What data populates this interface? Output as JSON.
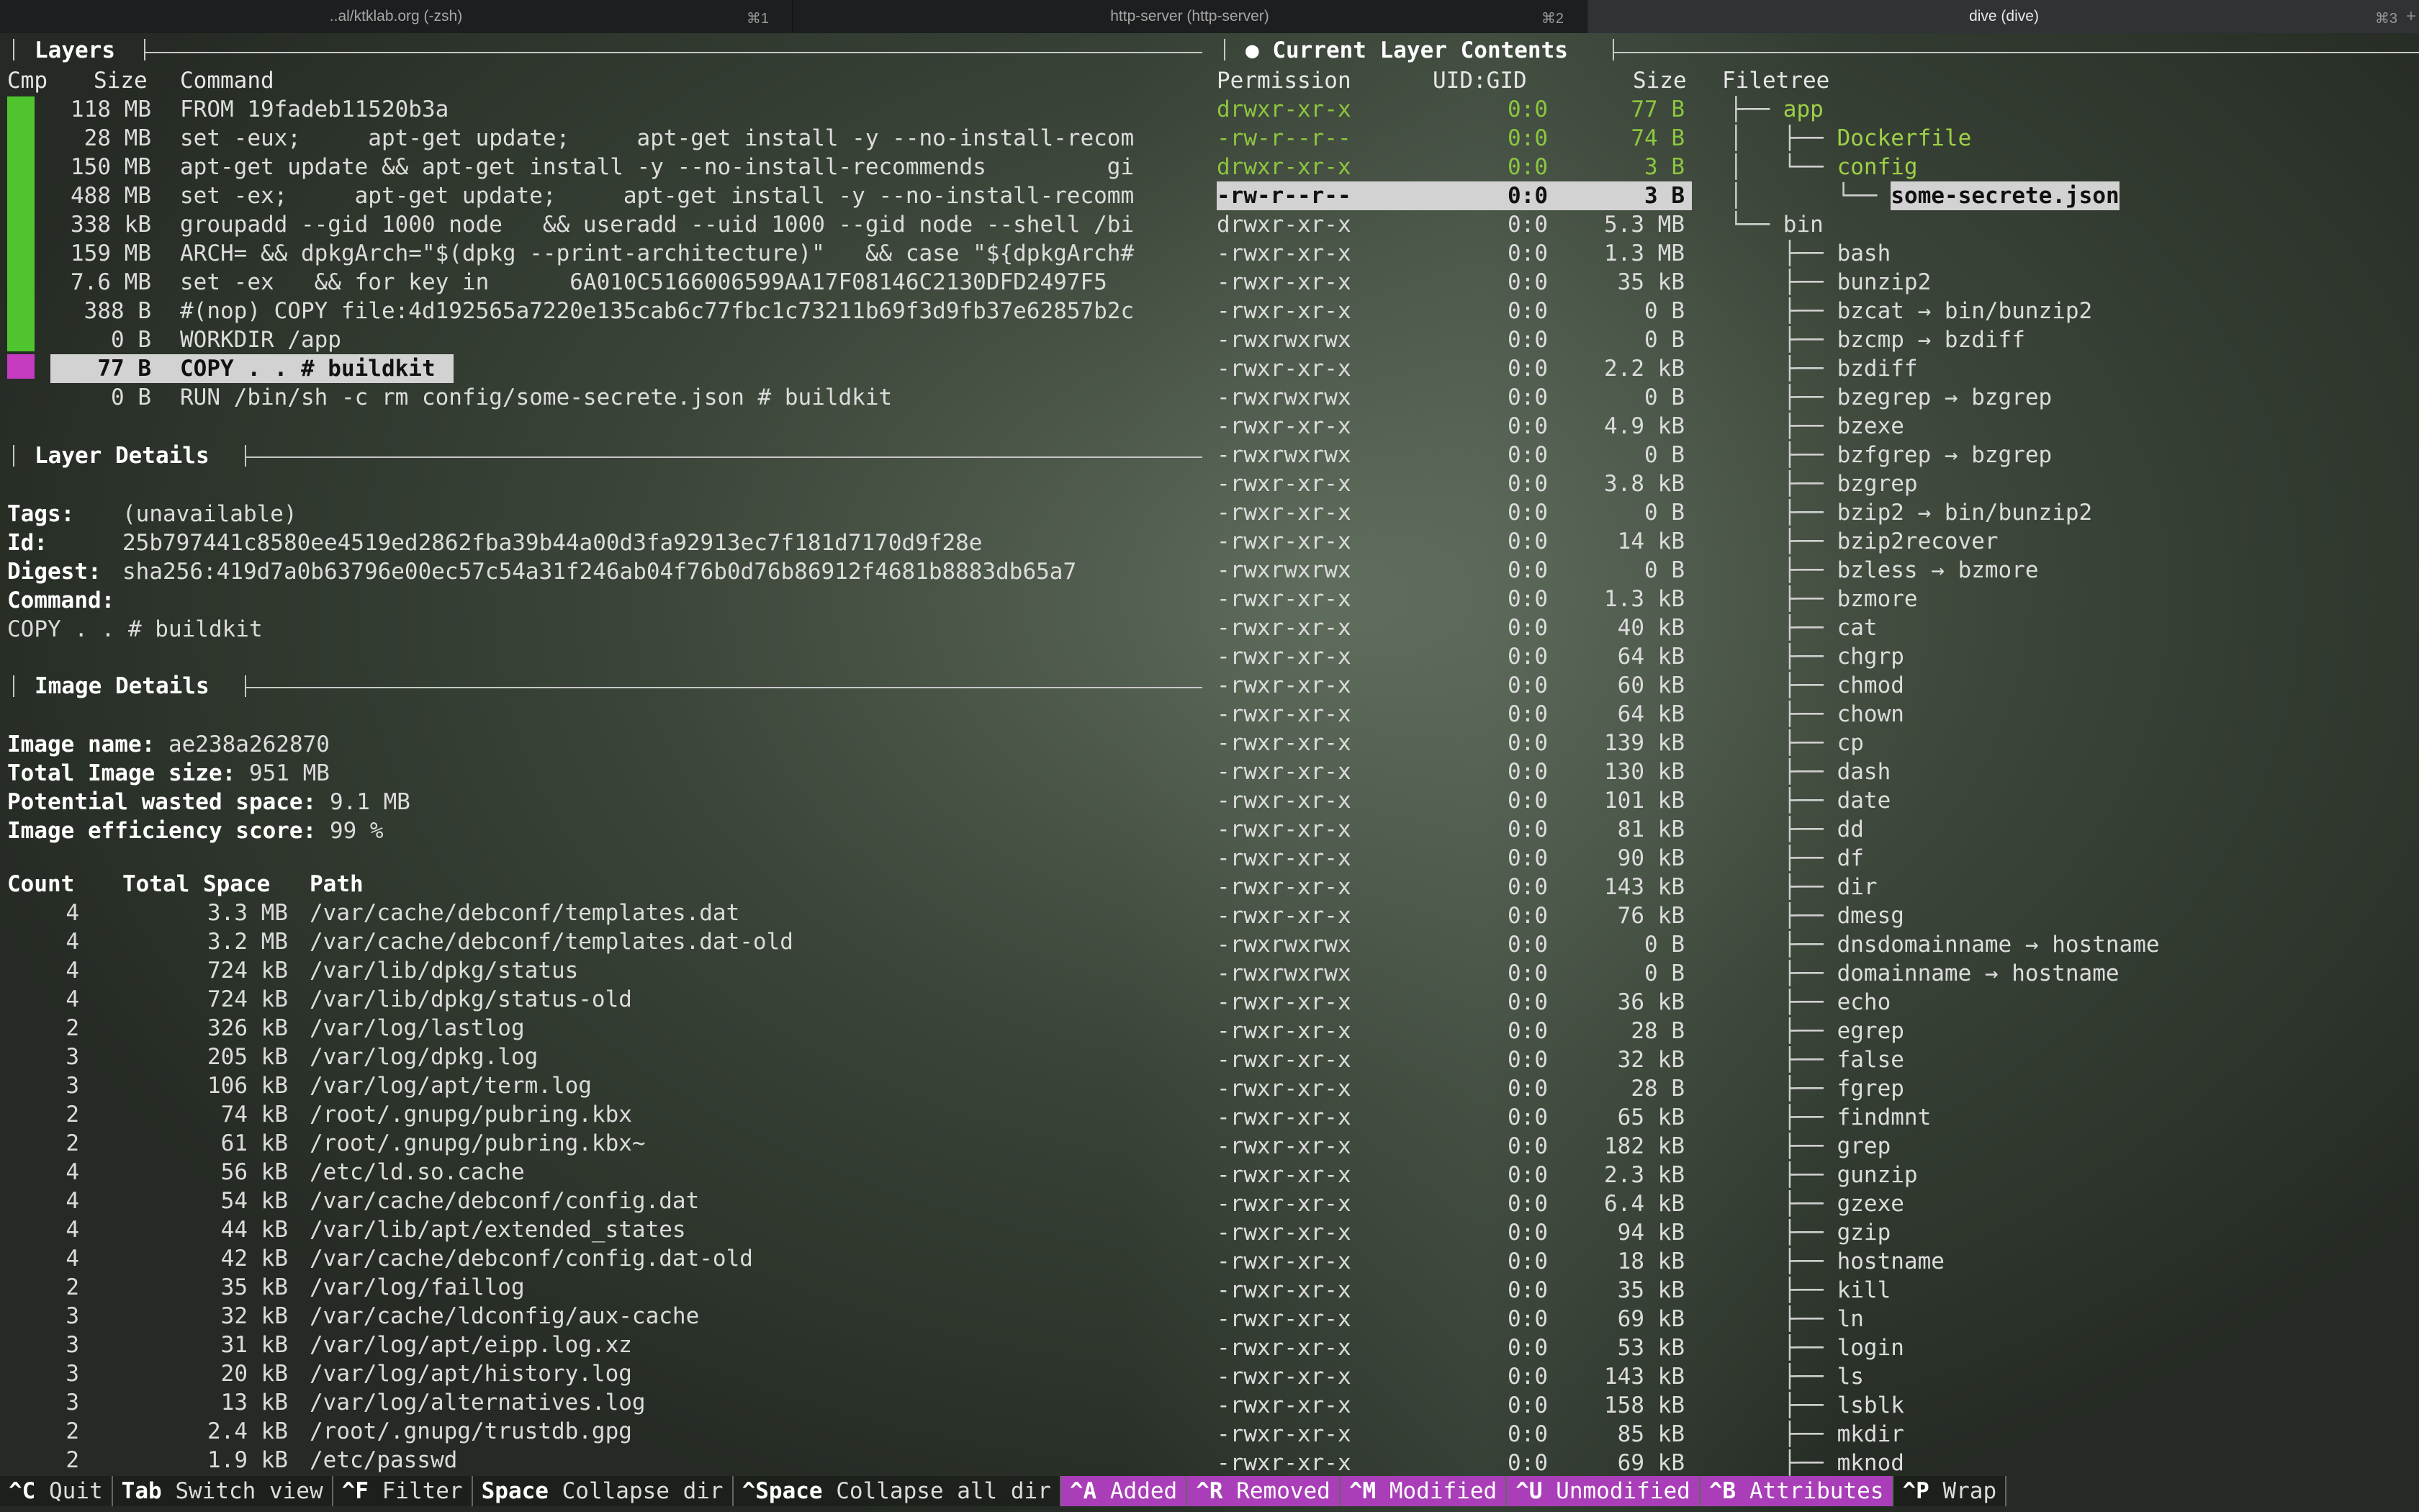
{
  "tabs": [
    {
      "label": "..al/ktklab.org (-zsh)",
      "shortcut": "⌘1"
    },
    {
      "label": "http-server (http-server)",
      "shortcut": "⌘2"
    },
    {
      "label": "dive (dive)",
      "shortcut": "⌘3"
    }
  ],
  "layers": {
    "title": "Layers",
    "headers": {
      "cmp": "Cmp",
      "size": "Size",
      "command": "Command"
    },
    "rows": [
      {
        "size": "118 MB",
        "command": "FROM 19fadeb11520b3a"
      },
      {
        "size": "28 MB",
        "command": "set -eux;     apt-get update;     apt-get install -y --no-install-recom"
      },
      {
        "size": "150 MB",
        "command": "apt-get update && apt-get install -y --no-install-recommends         gi"
      },
      {
        "size": "488 MB",
        "command": "set -ex;     apt-get update;     apt-get install -y --no-install-recomm"
      },
      {
        "size": "338 kB",
        "command": "groupadd --gid 1000 node   && useradd --uid 1000 --gid node --shell /bi"
      },
      {
        "size": "159 MB",
        "command": "ARCH= && dpkgArch=\"$(dpkg --print-architecture)\"   && case \"${dpkgArch#"
      },
      {
        "size": "7.6 MB",
        "command": "set -ex   && for key in      6A010C5166006599AA17F08146C2130DFD2497F5"
      },
      {
        "size": "388 B",
        "command": "#(nop) COPY file:4d192565a7220e135cab6c77fbc1c73211b69f3d9fb37e62857b2c"
      },
      {
        "size": "0 B",
        "command": "WORKDIR /app"
      },
      {
        "size": "77 B",
        "command": "COPY . . # buildkit"
      },
      {
        "size": "0 B",
        "command": "RUN /bin/sh -c rm config/some-secrete.json # buildkit"
      }
    ]
  },
  "layer_details": {
    "title": "Layer Details",
    "tags_label": "Tags:",
    "tags": "(unavailable)",
    "id_label": "Id:",
    "id": "25b797441c8580ee4519ed2862fba39b44a00d3fa92913ec7f181d7170d9f28e",
    "digest_label": "Digest:",
    "digest": "sha256:419d7a0b63796e00ec57c54a31f246ab04f76b0d76b86912f4681b8883db65a7",
    "command_label": "Command:",
    "command": "COPY . . # buildkit"
  },
  "image_details": {
    "title": "Image Details",
    "name_label": "Image name:",
    "name": "ae238a262870",
    "size_label": "Total Image size:",
    "size": "951 MB",
    "wasted_label": "Potential wasted space:",
    "wasted": "9.1 MB",
    "eff_label": "Image efficiency score:",
    "eff": "99 %",
    "headers": {
      "count": "Count",
      "total": "Total Space",
      "path": "Path"
    },
    "rows": [
      {
        "count": "4",
        "total": "3.3 MB",
        "path": "/var/cache/debconf/templates.dat"
      },
      {
        "count": "4",
        "total": "3.2 MB",
        "path": "/var/cache/debconf/templates.dat-old"
      },
      {
        "count": "4",
        "total": "724 kB",
        "path": "/var/lib/dpkg/status"
      },
      {
        "count": "4",
        "total": "724 kB",
        "path": "/var/lib/dpkg/status-old"
      },
      {
        "count": "2",
        "total": "326 kB",
        "path": "/var/log/lastlog"
      },
      {
        "count": "3",
        "total": "205 kB",
        "path": "/var/log/dpkg.log"
      },
      {
        "count": "3",
        "total": "106 kB",
        "path": "/var/log/apt/term.log"
      },
      {
        "count": "2",
        "total": "74 kB",
        "path": "/root/.gnupg/pubring.kbx"
      },
      {
        "count": "2",
        "total": "61 kB",
        "path": "/root/.gnupg/pubring.kbx~"
      },
      {
        "count": "4",
        "total": "56 kB",
        "path": "/etc/ld.so.cache"
      },
      {
        "count": "4",
        "total": "54 kB",
        "path": "/var/cache/debconf/config.dat"
      },
      {
        "count": "4",
        "total": "44 kB",
        "path": "/var/lib/apt/extended_states"
      },
      {
        "count": "4",
        "total": "42 kB",
        "path": "/var/cache/debconf/config.dat-old"
      },
      {
        "count": "2",
        "total": "35 kB",
        "path": "/var/log/faillog"
      },
      {
        "count": "3",
        "total": "32 kB",
        "path": "/var/cache/ldconfig/aux-cache"
      },
      {
        "count": "3",
        "total": "31 kB",
        "path": "/var/log/apt/eipp.log.xz"
      },
      {
        "count": "3",
        "total": "20 kB",
        "path": "/var/log/apt/history.log"
      },
      {
        "count": "3",
        "total": "13 kB",
        "path": "/var/log/alternatives.log"
      },
      {
        "count": "2",
        "total": "2.4 kB",
        "path": "/root/.gnupg/trustdb.gpg"
      },
      {
        "count": "2",
        "total": "1.9 kB",
        "path": "/etc/passwd"
      }
    ]
  },
  "contents": {
    "title": "● Current Layer Contents",
    "headers": {
      "perm": "Permission",
      "uid": "UID:GID",
      "size": "Size",
      "tree": "Filetree"
    },
    "rows": [
      {
        "perm": "drwxr-xr-x",
        "uid": "0:0",
        "size": "77 B",
        "prefix": "├── ",
        "name": "app",
        "style": "green"
      },
      {
        "perm": "-rw-r--r--",
        "uid": "0:0",
        "size": "74 B",
        "prefix": "│   ├── ",
        "name": "Dockerfile",
        "style": "green"
      },
      {
        "perm": "drwxr-xr-x",
        "uid": "0:0",
        "size": "3 B",
        "prefix": "│   └── ",
        "name": "config",
        "style": "green"
      },
      {
        "perm": "-rw-r--r--",
        "uid": "0:0",
        "size": "3 B",
        "prefix": "│       └── ",
        "name": "some-secrete.json",
        "style": "hl"
      },
      {
        "perm": "drwxr-xr-x",
        "uid": "0:0",
        "size": "5.3 MB",
        "prefix": "└── ",
        "name": "bin",
        "style": ""
      },
      {
        "perm": "-rwxr-xr-x",
        "uid": "0:0",
        "size": "1.3 MB",
        "prefix": "    ├── ",
        "name": "bash",
        "style": ""
      },
      {
        "perm": "-rwxr-xr-x",
        "uid": "0:0",
        "size": "35 kB",
        "prefix": "    ├── ",
        "name": "bunzip2",
        "style": ""
      },
      {
        "perm": "-rwxr-xr-x",
        "uid": "0:0",
        "size": "0 B",
        "prefix": "    ├── ",
        "name": "bzcat → bin/bunzip2",
        "style": ""
      },
      {
        "perm": "-rwxrwxrwx",
        "uid": "0:0",
        "size": "0 B",
        "prefix": "    ├── ",
        "name": "bzcmp → bzdiff",
        "style": ""
      },
      {
        "perm": "-rwxr-xr-x",
        "uid": "0:0",
        "size": "2.2 kB",
        "prefix": "    ├── ",
        "name": "bzdiff",
        "style": ""
      },
      {
        "perm": "-rwxrwxrwx",
        "uid": "0:0",
        "size": "0 B",
        "prefix": "    ├── ",
        "name": "bzegrep → bzgrep",
        "style": ""
      },
      {
        "perm": "-rwxr-xr-x",
        "uid": "0:0",
        "size": "4.9 kB",
        "prefix": "    ├── ",
        "name": "bzexe",
        "style": ""
      },
      {
        "perm": "-rwxrwxrwx",
        "uid": "0:0",
        "size": "0 B",
        "prefix": "    ├── ",
        "name": "bzfgrep → bzgrep",
        "style": ""
      },
      {
        "perm": "-rwxr-xr-x",
        "uid": "0:0",
        "size": "3.8 kB",
        "prefix": "    ├── ",
        "name": "bzgrep",
        "style": ""
      },
      {
        "perm": "-rwxr-xr-x",
        "uid": "0:0",
        "size": "0 B",
        "prefix": "    ├── ",
        "name": "bzip2 → bin/bunzip2",
        "style": ""
      },
      {
        "perm": "-rwxr-xr-x",
        "uid": "0:0",
        "size": "14 kB",
        "prefix": "    ├── ",
        "name": "bzip2recover",
        "style": ""
      },
      {
        "perm": "-rwxrwxrwx",
        "uid": "0:0",
        "size": "0 B",
        "prefix": "    ├── ",
        "name": "bzless → bzmore",
        "style": ""
      },
      {
        "perm": "-rwxr-xr-x",
        "uid": "0:0",
        "size": "1.3 kB",
        "prefix": "    ├── ",
        "name": "bzmore",
        "style": ""
      },
      {
        "perm": "-rwxr-xr-x",
        "uid": "0:0",
        "size": "40 kB",
        "prefix": "    ├── ",
        "name": "cat",
        "style": ""
      },
      {
        "perm": "-rwxr-xr-x",
        "uid": "0:0",
        "size": "64 kB",
        "prefix": "    ├── ",
        "name": "chgrp",
        "style": ""
      },
      {
        "perm": "-rwxr-xr-x",
        "uid": "0:0",
        "size": "60 kB",
        "prefix": "    ├── ",
        "name": "chmod",
        "style": ""
      },
      {
        "perm": "-rwxr-xr-x",
        "uid": "0:0",
        "size": "64 kB",
        "prefix": "    ├── ",
        "name": "chown",
        "style": ""
      },
      {
        "perm": "-rwxr-xr-x",
        "uid": "0:0",
        "size": "139 kB",
        "prefix": "    ├── ",
        "name": "cp",
        "style": ""
      },
      {
        "perm": "-rwxr-xr-x",
        "uid": "0:0",
        "size": "130 kB",
        "prefix": "    ├── ",
        "name": "dash",
        "style": ""
      },
      {
        "perm": "-rwxr-xr-x",
        "uid": "0:0",
        "size": "101 kB",
        "prefix": "    ├── ",
        "name": "date",
        "style": ""
      },
      {
        "perm": "-rwxr-xr-x",
        "uid": "0:0",
        "size": "81 kB",
        "prefix": "    ├── ",
        "name": "dd",
        "style": ""
      },
      {
        "perm": "-rwxr-xr-x",
        "uid": "0:0",
        "size": "90 kB",
        "prefix": "    ├── ",
        "name": "df",
        "style": ""
      },
      {
        "perm": "-rwxr-xr-x",
        "uid": "0:0",
        "size": "143 kB",
        "prefix": "    ├── ",
        "name": "dir",
        "style": ""
      },
      {
        "perm": "-rwxr-xr-x",
        "uid": "0:0",
        "size": "76 kB",
        "prefix": "    ├── ",
        "name": "dmesg",
        "style": ""
      },
      {
        "perm": "-rwxrwxrwx",
        "uid": "0:0",
        "size": "0 B",
        "prefix": "    ├── ",
        "name": "dnsdomainname → hostname",
        "style": ""
      },
      {
        "perm": "-rwxrwxrwx",
        "uid": "0:0",
        "size": "0 B",
        "prefix": "    ├── ",
        "name": "domainname → hostname",
        "style": ""
      },
      {
        "perm": "-rwxr-xr-x",
        "uid": "0:0",
        "size": "36 kB",
        "prefix": "    ├── ",
        "name": "echo",
        "style": ""
      },
      {
        "perm": "-rwxr-xr-x",
        "uid": "0:0",
        "size": "28 B",
        "prefix": "    ├── ",
        "name": "egrep",
        "style": ""
      },
      {
        "perm": "-rwxr-xr-x",
        "uid": "0:0",
        "size": "32 kB",
        "prefix": "    ├── ",
        "name": "false",
        "style": ""
      },
      {
        "perm": "-rwxr-xr-x",
        "uid": "0:0",
        "size": "28 B",
        "prefix": "    ├── ",
        "name": "fgrep",
        "style": ""
      },
      {
        "perm": "-rwxr-xr-x",
        "uid": "0:0",
        "size": "65 kB",
        "prefix": "    ├── ",
        "name": "findmnt",
        "style": ""
      },
      {
        "perm": "-rwxr-xr-x",
        "uid": "0:0",
        "size": "182 kB",
        "prefix": "    ├── ",
        "name": "grep",
        "style": ""
      },
      {
        "perm": "-rwxr-xr-x",
        "uid": "0:0",
        "size": "2.3 kB",
        "prefix": "    ├── ",
        "name": "gunzip",
        "style": ""
      },
      {
        "perm": "-rwxr-xr-x",
        "uid": "0:0",
        "size": "6.4 kB",
        "prefix": "    ├── ",
        "name": "gzexe",
        "style": ""
      },
      {
        "perm": "-rwxr-xr-x",
        "uid": "0:0",
        "size": "94 kB",
        "prefix": "    ├── ",
        "name": "gzip",
        "style": ""
      },
      {
        "perm": "-rwxr-xr-x",
        "uid": "0:0",
        "size": "18 kB",
        "prefix": "    ├── ",
        "name": "hostname",
        "style": ""
      },
      {
        "perm": "-rwxr-xr-x",
        "uid": "0:0",
        "size": "35 kB",
        "prefix": "    ├── ",
        "name": "kill",
        "style": ""
      },
      {
        "perm": "-rwxr-xr-x",
        "uid": "0:0",
        "size": "69 kB",
        "prefix": "    ├── ",
        "name": "ln",
        "style": ""
      },
      {
        "perm": "-rwxr-xr-x",
        "uid": "0:0",
        "size": "53 kB",
        "prefix": "    ├── ",
        "name": "login",
        "style": ""
      },
      {
        "perm": "-rwxr-xr-x",
        "uid": "0:0",
        "size": "143 kB",
        "prefix": "    ├── ",
        "name": "ls",
        "style": ""
      },
      {
        "perm": "-rwxr-xr-x",
        "uid": "0:0",
        "size": "158 kB",
        "prefix": "    ├── ",
        "name": "lsblk",
        "style": ""
      },
      {
        "perm": "-rwxr-xr-x",
        "uid": "0:0",
        "size": "85 kB",
        "prefix": "    ├── ",
        "name": "mkdir",
        "style": ""
      },
      {
        "perm": "-rwxr-xr-x",
        "uid": "0:0",
        "size": "69 kB",
        "prefix": "    ├── ",
        "name": "mknod",
        "style": ""
      }
    ]
  },
  "keybar": [
    {
      "key": "^C",
      "label": "Quit",
      "active": false
    },
    {
      "key": "Tab",
      "label": "Switch view",
      "active": false
    },
    {
      "key": "^F",
      "label": "Filter",
      "active": false
    },
    {
      "key": "Space",
      "label": "Collapse dir",
      "active": false
    },
    {
      "key": "^Space",
      "label": "Collapse all dir",
      "active": false
    },
    {
      "key": "^A",
      "label": "Added",
      "active": true
    },
    {
      "key": "^R",
      "label": "Removed",
      "active": true
    },
    {
      "key": "^M",
      "label": "Modified",
      "active": true
    },
    {
      "key": "^U",
      "label": "Unmodified",
      "active": true
    },
    {
      "key": "^B",
      "label": "Attributes",
      "active": true
    },
    {
      "key": "^P",
      "label": "Wrap",
      "active": false
    }
  ],
  "colors": {
    "added_bar": "#4fc42e",
    "selected_bar": "#c43bc0",
    "tree_green": "#9ed047",
    "key_active": "#a93eb8"
  }
}
